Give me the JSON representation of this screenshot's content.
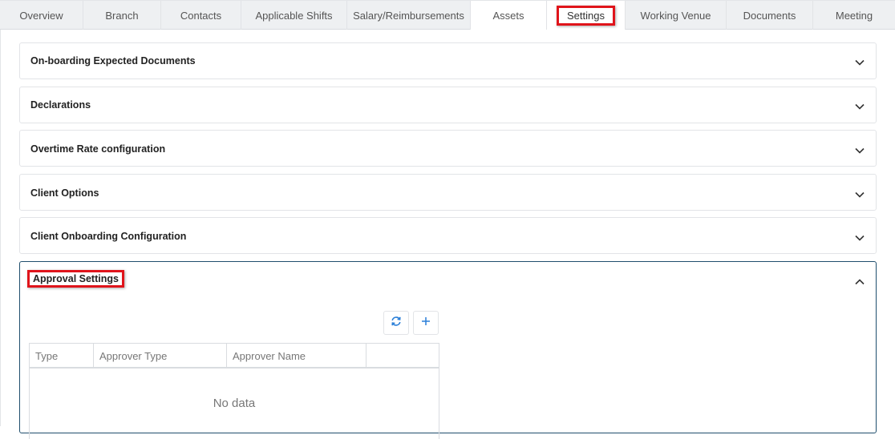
{
  "tabs": [
    {
      "label": "Overview"
    },
    {
      "label": "Branch"
    },
    {
      "label": "Contacts"
    },
    {
      "label": "Applicable Shifts"
    },
    {
      "label": "Salary/Reimbursements"
    },
    {
      "label": "Assets"
    },
    {
      "label": "Settings",
      "active": true
    },
    {
      "label": "Working Venue"
    },
    {
      "label": "Documents"
    },
    {
      "label": "Meeting"
    }
  ],
  "panels": [
    {
      "title": "On-boarding Expected Documents",
      "expanded": false
    },
    {
      "title": "Declarations",
      "expanded": false
    },
    {
      "title": "Overtime Rate configuration",
      "expanded": false
    },
    {
      "title": "Client Options",
      "expanded": false
    },
    {
      "title": "Client Onboarding Configuration",
      "expanded": false
    },
    {
      "title": "Approval Settings",
      "expanded": true
    }
  ],
  "approval_grid": {
    "columns": [
      "Type",
      "Approver Type",
      "Approver Name",
      ""
    ],
    "empty_text": "No data"
  },
  "toolbar": {
    "refresh_icon": "refresh-icon",
    "add_icon": "plus-icon"
  },
  "colors": {
    "accent": "#2b7fd8",
    "highlight": "#e0141b",
    "open_border": "#1f4e6d"
  }
}
